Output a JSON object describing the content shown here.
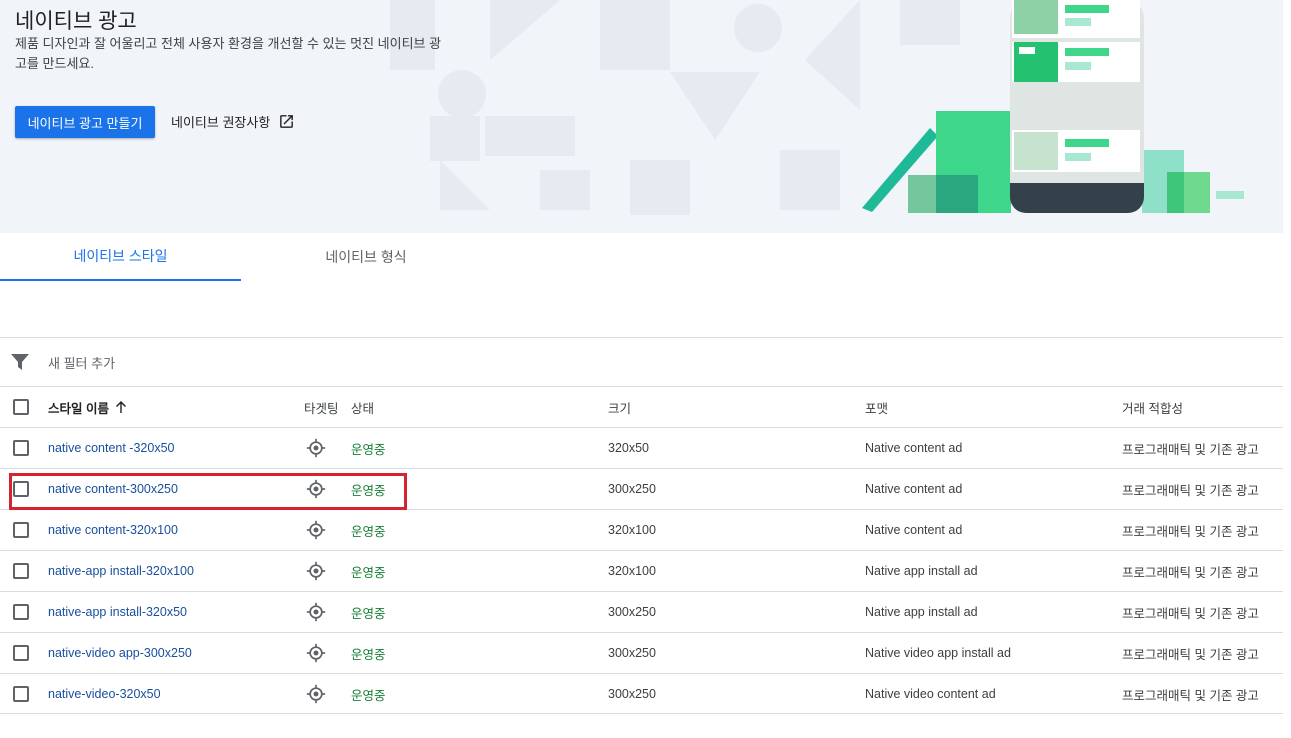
{
  "hero": {
    "title": "네이티브 광고",
    "description": "제품 디자인과 잘 어울리고 전체 사용자 환경을 개선할 수 있는 멋진 네이티브 광고를 만드세요.",
    "create_button": "네이티브 광고 만들기",
    "guide_link": "네이티브 권장사항",
    "guide_icon": "open-in-new-icon"
  },
  "tabs": [
    {
      "label": "네이티브 스타일",
      "active": true
    },
    {
      "label": "네이티브 형식",
      "active": false
    }
  ],
  "filter": {
    "icon": "filter-icon",
    "placeholder": "새 필터 추가"
  },
  "table": {
    "headers": {
      "name": "스타일 이름",
      "target": "타겟팅",
      "status": "상태",
      "size": "크기",
      "format": "포맷",
      "deal": "거래 적합성"
    },
    "sort_icon": "arrow-up-icon",
    "rows": [
      {
        "name": "native content -320x50",
        "status": "운영중",
        "size": "320x50",
        "format": "Native content ad",
        "deal": "프로그래매틱 및 기존 광고"
      },
      {
        "name": "native content-300x250",
        "status": "운영중",
        "size": "300x250",
        "format": "Native content ad",
        "deal": "프로그래매틱 및 기존 광고"
      },
      {
        "name": "native content-320x100",
        "status": "운영중",
        "size": "320x100",
        "format": "Native content ad",
        "deal": "프로그래매틱 및 기존 광고"
      },
      {
        "name": "native-app install-320x100",
        "status": "운영중",
        "size": "320x100",
        "format": "Native app install ad",
        "deal": "프로그래매틱 및 기존 광고"
      },
      {
        "name": "native-app install-320x50",
        "status": "운영중",
        "size": "300x250",
        "format": "Native app install ad",
        "deal": "프로그래매틱 및 기존 광고"
      },
      {
        "name": "native-video app-300x250",
        "status": "운영중",
        "size": "300x250",
        "format": "Native video app install ad",
        "deal": "프로그래매틱 및 기존 광고"
      },
      {
        "name": "native-video-320x50",
        "status": "운영중",
        "size": "300x250",
        "format": "Native video content ad",
        "deal": "프로그래매틱 및 기존 광고"
      }
    ]
  },
  "colors": {
    "accent": "#1a73e8",
    "status_active": "#188038",
    "highlight": "#d7232f"
  }
}
